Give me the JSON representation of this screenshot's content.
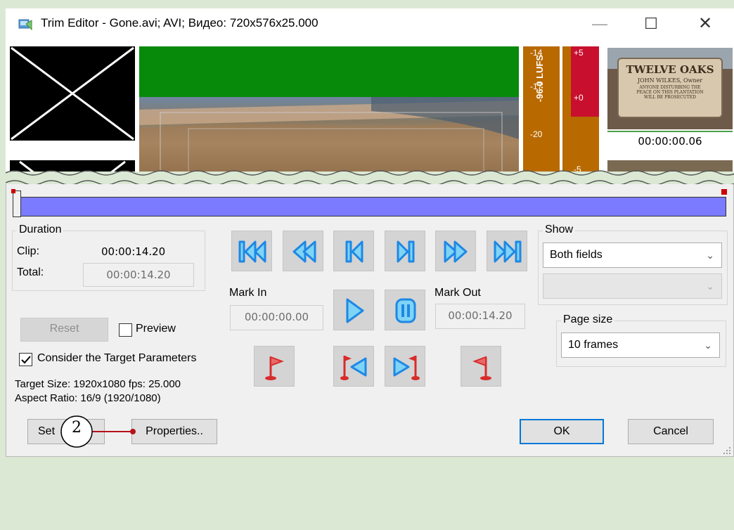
{
  "window": {
    "title": "Trim Editor - Gone.avi; AVI; Видео: 720x576x25.000",
    "minimize_symbol": "—",
    "maximize_symbol": "☐",
    "close_symbol": "✕"
  },
  "video": {
    "meter_lufs": "-96.0 LUFS",
    "scale_left": [
      "-14",
      "-17",
      "-20"
    ],
    "scale_right": [
      "+5",
      "+0",
      "-5"
    ],
    "thumb_sign_title": "TWELVE OAKS",
    "thumb_sign_sub": "JOHN WILKES, Owner",
    "thumb_sign_text": "ANYONE DISTURBING THE PEACE ON THIS PLANTATION WILL BE PROSECUTED",
    "thumb_time": "00:00:00.06"
  },
  "duration": {
    "legend": "Duration",
    "clip_label": "Clip:",
    "clip_value": "00:00:14.20",
    "total_label": "Total:",
    "total_value": "00:00:14.20"
  },
  "mark": {
    "in_label": "Mark In",
    "in_value": "00:00:00.00",
    "out_label": "Mark Out",
    "out_value": "00:00:14.20"
  },
  "show": {
    "legend": "Show",
    "fields_value": "Both fields",
    "second_value": ""
  },
  "page_size": {
    "legend": "Page size",
    "value": "10 frames"
  },
  "buttons": {
    "reset": "Reset",
    "settings": "Set",
    "properties": "Properties..",
    "ok": "OK",
    "cancel": "Cancel"
  },
  "checks": {
    "preview_label": "Preview",
    "preview_checked": false,
    "target_label": "Consider the Target Parameters",
    "target_checked": true
  },
  "target_info": {
    "size_line": "Target Size: 1920x1080 fps: 25.000",
    "aspect_line": "Aspect Ratio: 16/9 (1920/1080)"
  },
  "callout": {
    "number": "2"
  },
  "colors": {
    "accent": "#0078d7",
    "timeline": "#7b7bff",
    "nav_icon": "#1e88e5",
    "flag": "#d92b2b",
    "meter_orange": "#b86a00",
    "meter_red": "#c8102e",
    "background": "#dbe9d4"
  },
  "icons": [
    "app-icon",
    "go-start-icon",
    "rewind-icon",
    "prev-frame-icon",
    "next-frame-icon",
    "fast-forward-icon",
    "go-end-icon",
    "play-icon",
    "pause-icon",
    "mark-in-flag-icon",
    "go-to-mark-in-icon",
    "go-to-mark-out-icon",
    "mark-out-flag-icon"
  ]
}
